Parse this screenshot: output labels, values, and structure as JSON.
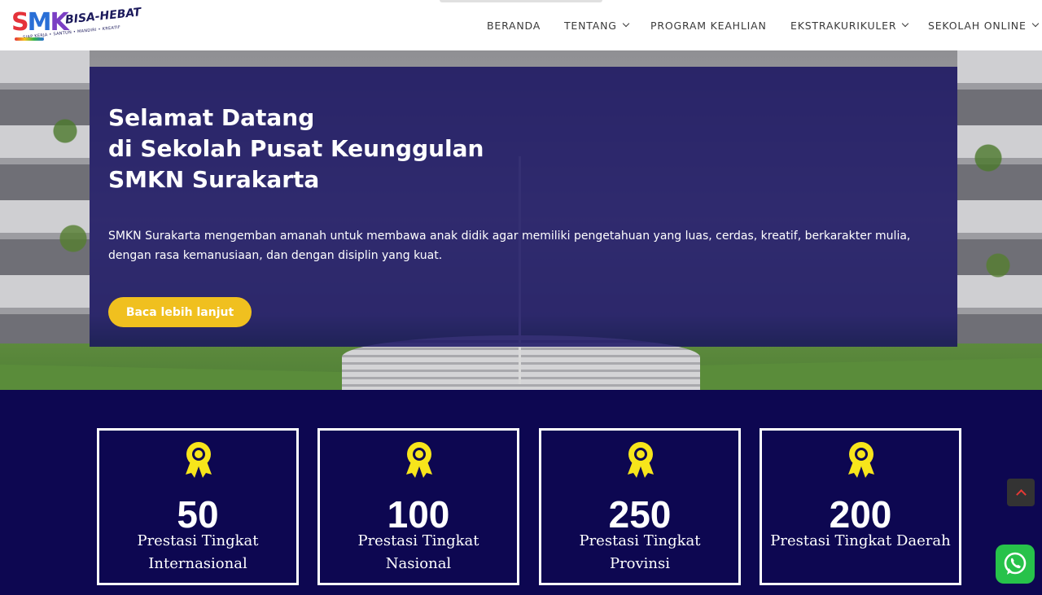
{
  "logo": {
    "smk_letters": [
      "S",
      "M",
      "K"
    ],
    "brand": "BISA-HEBAT",
    "tagline": "SIAP KERJA • SANTUN • MANDIRI • KREATIF"
  },
  "nav": {
    "items": [
      {
        "label": "BERANDA",
        "has_dropdown": false
      },
      {
        "label": "TENTANG",
        "has_dropdown": true
      },
      {
        "label": "PROGRAM KEAHLIAN",
        "has_dropdown": false
      },
      {
        "label": "EKSTRAKURIKULER",
        "has_dropdown": true
      },
      {
        "label": "SEKOLAH ONLINE",
        "has_dropdown": true
      }
    ]
  },
  "hero": {
    "title_lines": [
      "Selamat Datang",
      "di Sekolah Pusat Keunggulan",
      "SMKN Surakarta"
    ],
    "description": "SMKN Surakarta mengemban amanah untuk membawa anak didik agar memiliki pengetahuan yang luas, cerdas, kreatif, berkarakter mulia, dengan rasa kemanusiaan, dan dengan disiplin yang kuat.",
    "button_label": "Baca lebih lanjut"
  },
  "stats": [
    {
      "value": "50",
      "label": "Prestasi Tingkat Internasional",
      "icon": "award-medal-icon"
    },
    {
      "value": "100",
      "label": "Prestasi Tingkat Nasional",
      "icon": "award-medal-icon"
    },
    {
      "value": "250",
      "label": "Prestasi Tingkat Provinsi",
      "icon": "award-medal-icon"
    },
    {
      "value": "200",
      "label": "Prestasi Tingkat Daerah",
      "icon": "award-medal-icon"
    }
  ],
  "colors": {
    "primary_navy": "#0d0751",
    "overlay": "#160f5f",
    "accent_yellow": "#f0c01f",
    "whatsapp_green": "#27c24a"
  },
  "floating": {
    "scroll_top_icon": "chevron-up-icon",
    "whatsapp_icon": "whatsapp-icon"
  }
}
